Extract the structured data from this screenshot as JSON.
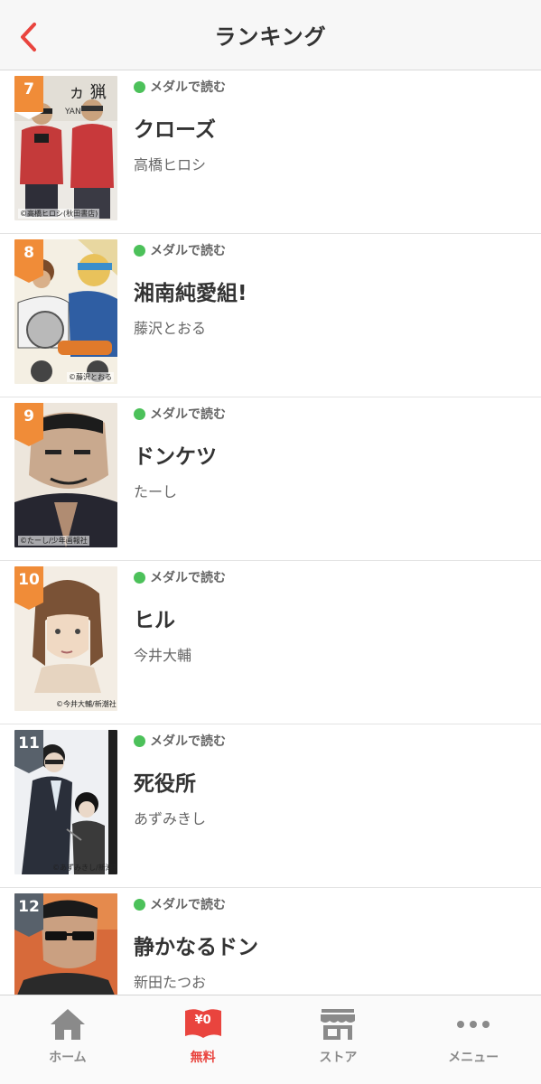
{
  "header": {
    "title": "ランキング"
  },
  "colors": {
    "accent": "#e9443e",
    "rank_top": "#f08c38",
    "rank_rest": "#58616b",
    "medal_dot": "#4cc15a",
    "tab_inactive": "#8a8a8a"
  },
  "items": [
    {
      "rank": "7",
      "tag": "メダルで読む",
      "title": "クローズ",
      "author": "高橋ヒロシ",
      "credit": "©高橋ヒロシ(秋田書店)"
    },
    {
      "rank": "8",
      "tag": "メダルで読む",
      "title": "湘南純愛組!",
      "author": "藤沢とおる",
      "credit": "©藤沢とおる"
    },
    {
      "rank": "9",
      "tag": "メダルで読む",
      "title": "ドンケツ",
      "author": "たーし",
      "credit": "©たーし/少年画報社"
    },
    {
      "rank": "10",
      "tag": "メダルで読む",
      "title": "ヒル",
      "author": "今井大輔",
      "credit": "©今井大輔/新潮社"
    },
    {
      "rank": "11",
      "tag": "メダルで読む",
      "title": "死役所",
      "author": "あずみきし",
      "credit": "©あずみきし/新潮社"
    },
    {
      "rank": "12",
      "tag": "メダルで読む",
      "title": "静かなるドン",
      "author": "新田たつお",
      "credit": ""
    }
  ],
  "tabbar": {
    "home": {
      "label": "ホーム",
      "icon": "home-icon"
    },
    "free": {
      "label": "無料",
      "icon": "free-book-icon",
      "badge": "¥0"
    },
    "store": {
      "label": "ストア",
      "icon": "store-icon"
    },
    "menu": {
      "label": "メニュー",
      "icon": "more-dots-icon"
    }
  }
}
